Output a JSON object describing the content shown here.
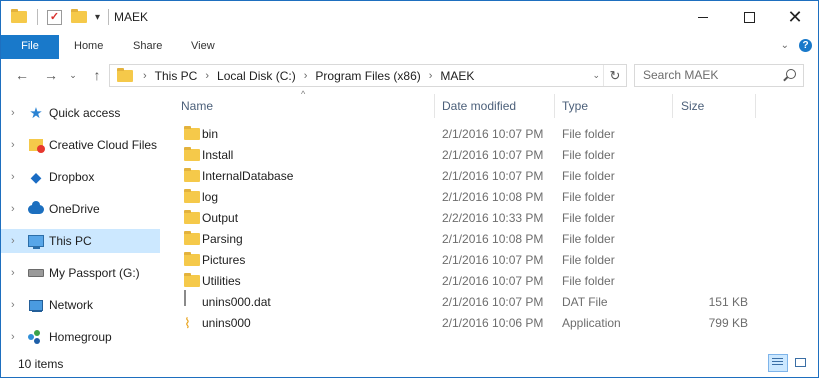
{
  "window": {
    "title": "MAEK"
  },
  "ribbon": {
    "tabs": [
      {
        "label": "File"
      },
      {
        "label": "Home"
      },
      {
        "label": "Share"
      },
      {
        "label": "View"
      }
    ],
    "help_glyph": "?"
  },
  "address": {
    "crumbs": [
      "This PC",
      "Local Disk (C:)",
      "Program Files (x86)",
      "MAEK"
    ]
  },
  "search": {
    "placeholder": "Search MAEK"
  },
  "nav_pane": {
    "items": [
      {
        "label": "Quick access",
        "icon": "star-icon"
      },
      {
        "label": "Creative Cloud Files",
        "icon": "creative-cloud-icon"
      },
      {
        "label": "Dropbox",
        "icon": "dropbox-icon"
      },
      {
        "label": "OneDrive",
        "icon": "onedrive-icon"
      },
      {
        "label": "This PC",
        "icon": "this-pc-icon",
        "selected": true
      },
      {
        "label": "My Passport (G:)",
        "icon": "drive-icon"
      },
      {
        "label": "Network",
        "icon": "network-icon"
      },
      {
        "label": "Homegroup",
        "icon": "homegroup-icon"
      }
    ]
  },
  "file_list": {
    "columns": {
      "name": "Name",
      "date": "Date modified",
      "type": "Type",
      "size": "Size"
    },
    "rows": [
      {
        "name": "bin",
        "date": "2/1/2016 10:07 PM",
        "type": "File folder",
        "size": "",
        "icon": "folder-icon"
      },
      {
        "name": "Install",
        "date": "2/1/2016 10:07 PM",
        "type": "File folder",
        "size": "",
        "icon": "folder-icon"
      },
      {
        "name": "InternalDatabase",
        "date": "2/1/2016 10:07 PM",
        "type": "File folder",
        "size": "",
        "icon": "folder-icon"
      },
      {
        "name": "log",
        "date": "2/1/2016 10:08 PM",
        "type": "File folder",
        "size": "",
        "icon": "folder-icon"
      },
      {
        "name": "Output",
        "date": "2/2/2016 10:33 PM",
        "type": "File folder",
        "size": "",
        "icon": "folder-icon"
      },
      {
        "name": "Parsing",
        "date": "2/1/2016 10:08 PM",
        "type": "File folder",
        "size": "",
        "icon": "folder-icon"
      },
      {
        "name": "Pictures",
        "date": "2/1/2016 10:07 PM",
        "type": "File folder",
        "size": "",
        "icon": "folder-icon"
      },
      {
        "name": "Utilities",
        "date": "2/1/2016 10:07 PM",
        "type": "File folder",
        "size": "",
        "icon": "folder-icon"
      },
      {
        "name": "unins000.dat",
        "date": "2/1/2016 10:07 PM",
        "type": "DAT File",
        "size": "151 KB",
        "icon": "file-icon"
      },
      {
        "name": "unins000",
        "date": "2/1/2016 10:06 PM",
        "type": "Application",
        "size": "799 KB",
        "icon": "application-icon"
      }
    ]
  },
  "status": {
    "item_count": "10 items"
  },
  "colors": {
    "accent": "#1979ca",
    "selection": "#cce8ff",
    "folder": "#f5c94a",
    "header_text": "#4c607a"
  }
}
